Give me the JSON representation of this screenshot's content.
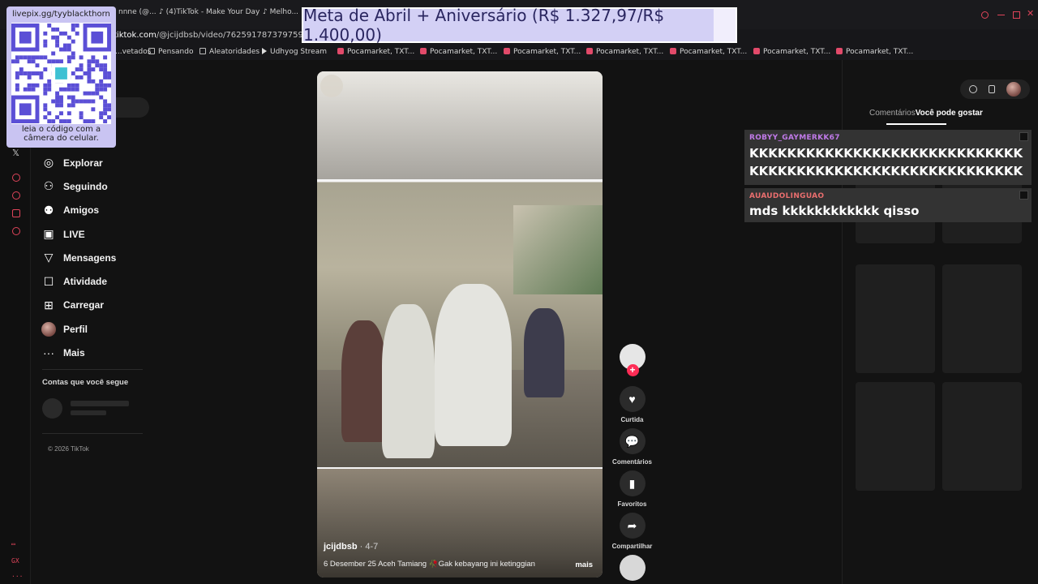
{
  "browser": {
    "tabs": [
      {
        "label": "nnne (@..."
      },
      {
        "label": "(4)TikTok - Make Your Day"
      },
      {
        "label": "Melho..."
      }
    ],
    "url_prefix": "",
    "url_domain": "tiktok.com",
    "url_path": "/@jcijdbsb/video/7625917873797598494",
    "bookmarks": [
      {
        "label": "...vetados",
        "icon": "folder-icon"
      },
      {
        "label": "Pensando",
        "icon": "folder-icon"
      },
      {
        "label": "Aleatoridades",
        "icon": "folder-icon"
      },
      {
        "label": "Udhyog Stream",
        "icon": "play-icon"
      },
      {
        "label": "Pocamarket, TXT...",
        "icon": "heart-icon"
      },
      {
        "label": "Pocamarket, TXT...",
        "icon": "heart-icon"
      },
      {
        "label": "Pocamarket, TXT...",
        "icon": "heart-icon"
      },
      {
        "label": "Pocamarket, TXT...",
        "icon": "heart-icon"
      },
      {
        "label": "Pocamarket, TXT...",
        "icon": "heart-icon"
      },
      {
        "label": "Pocamarket, TXT...",
        "icon": "heart-icon"
      },
      {
        "label": "Pocamarket, TXT...",
        "icon": "heart-icon"
      }
    ]
  },
  "overlay": {
    "qr_url": "livepix.gg/tyyblackthorn",
    "qr_caption": "leia o código com a câmera do celular.",
    "goal_text": "Meta de Abril + Aniversário (R$ 1.327,97/R$ 1.400,00)",
    "goal_progress": 0.9486
  },
  "nav": {
    "items": [
      {
        "label": "Explorar",
        "icon": "compass-icon"
      },
      {
        "label": "Seguindo",
        "icon": "following-icon"
      },
      {
        "label": "Amigos",
        "icon": "friends-icon"
      },
      {
        "label": "LIVE",
        "icon": "live-icon"
      },
      {
        "label": "Mensagens",
        "icon": "messages-icon"
      },
      {
        "label": "Atividade",
        "icon": "activity-icon"
      },
      {
        "label": "Carregar",
        "icon": "upload-icon"
      },
      {
        "label": "Perfil",
        "icon": "avatar"
      },
      {
        "label": "Mais",
        "icon": "more-icon"
      }
    ],
    "following_title": "Contas que você segue",
    "copyright": "© 2026 TikTok"
  },
  "video": {
    "username": "jcijdbsb",
    "date": " · 4-7",
    "description": "6 Desember 25 Aceh Tamiang 🥀Gak kebayang ini ketinggian",
    "more": "mais"
  },
  "actions": {
    "like": "Curtida",
    "comments": "Comentários",
    "favorites": "Favoritos",
    "share": "Compartilhar"
  },
  "right_panel": {
    "tab_comments": "Comentários",
    "tab_suggested": "Você pode gostar"
  },
  "chat": [
    {
      "user": "ROBYY_GAYMERKK67",
      "color": "#c07ae8",
      "text": "KKKKKKKKKKKKKKKKKKKKKKKKKKKKKKKKKKKKKKKKKKKKKKKKKKKKKKKKKK"
    },
    {
      "user": "AUAUDOLINGUAO",
      "color": "#e96e6e",
      "text": "mds kkkkkkkkkkkk qisso"
    }
  ],
  "colors": {
    "accent": "#fe2c55",
    "opera_red": "#e0445a"
  }
}
